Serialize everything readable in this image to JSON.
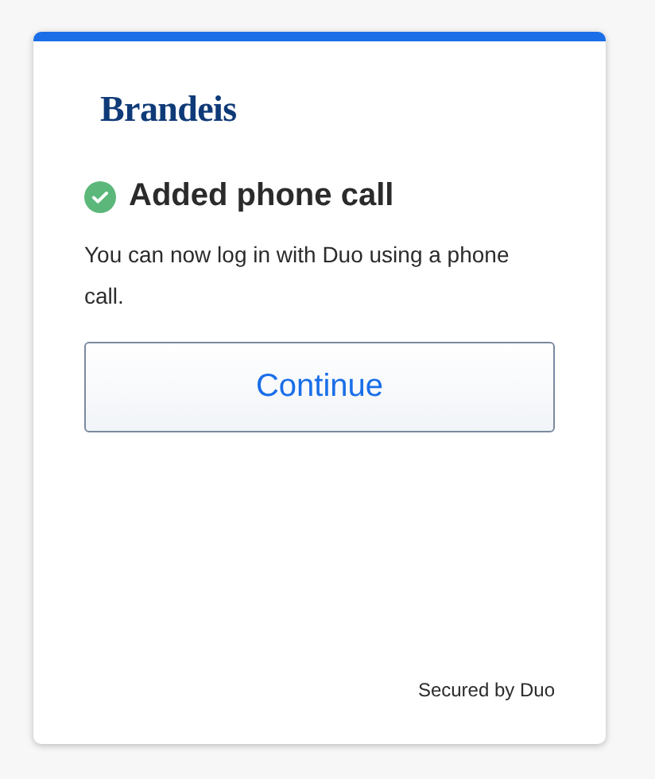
{
  "logo": "Brandeis",
  "status": {
    "kind": "success",
    "title": "Added phone call"
  },
  "message": "You can now log in with Duo using a phone call.",
  "button": "Continue",
  "footer": "Secured by Duo"
}
